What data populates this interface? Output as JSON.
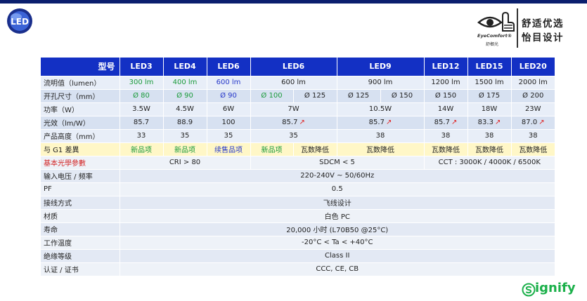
{
  "brand": {
    "eye_label": "EyeComfort®",
    "eye_sub": "舒榔光",
    "line1": "舒适优选",
    "line2": "怡目设计",
    "logo_text": "LED"
  },
  "colors": {
    "header_bg": "#1330c4",
    "topbar": "#0b1f6e",
    "new_item": "#1a9a3a",
    "discontinued": "#2537c9",
    "red_label": "#d22020",
    "signify": "#1bb04a"
  },
  "table": {
    "header": [
      "型号",
      "LED3",
      "LED4",
      "LED6",
      "LED6",
      "LED9",
      "LED12",
      "LED15",
      "LED20"
    ],
    "lumen": {
      "label": "流明值（lumen）",
      "values": [
        "300 lm",
        "400 lm",
        "600 lm",
        "600 lm",
        "900 lm",
        "1200 lm",
        "1500 lm",
        "2000 lm"
      ]
    },
    "cutout": {
      "label": "开孔尺寸（mm）",
      "values": [
        "Ø 80",
        "Ø 90",
        "Ø 90",
        "Ø 100",
        "Ø 125",
        "Ø 125",
        "Ø 150",
        "Ø 150",
        "Ø 175",
        "Ø 200"
      ]
    },
    "power": {
      "label": "功率（W）",
      "values": [
        "3.5W",
        "4.5W",
        "6W",
        "7W",
        "10.5W",
        "14W",
        "18W",
        "23W"
      ]
    },
    "efficacy": {
      "label": "光效（lm/W）",
      "values": [
        "85.7",
        "88.9",
        "100",
        "85.7",
        "85.7",
        "85.7",
        "83.3",
        "87.0"
      ]
    },
    "height": {
      "label": "产品高度（mm）",
      "values": [
        "33",
        "35",
        "35",
        "35",
        "38",
        "38",
        "38",
        "38"
      ]
    },
    "g1": {
      "label": "与 G1 差異",
      "values": [
        "新品项",
        "新品项",
        "续售品项",
        "新品项",
        "瓦数降低",
        "瓦数降低",
        "瓦数降低",
        "瓦数降低",
        "瓦数降低"
      ]
    },
    "optical": {
      "label": "基本光學參數",
      "cri": "CRI > 80",
      "sdcm": "SDCM < 5",
      "cct": "CCT : 3000K / 4000K / 6500K"
    },
    "voltage": {
      "label": "输入电压 / 频率",
      "value": "220-240V ~ 50/60Hz"
    },
    "pf": {
      "label": "PF",
      "value": "0.5"
    },
    "wiring": {
      "label": "接线方式",
      "value": "飞线设计"
    },
    "material": {
      "label": "材质",
      "value": "白色 PC"
    },
    "life": {
      "label": "寿命",
      "value": "20,000 小时 (L70B50 @25°C)"
    },
    "temp": {
      "label": "工作温度",
      "value": "-20°C < Ta < +40°C"
    },
    "insulation": {
      "label": "绝缘等级",
      "value": "Class II"
    },
    "cert": {
      "label": "认证 / 证书",
      "value": "CCC, CE, CB"
    }
  },
  "footer": {
    "signify_text": "ignify"
  }
}
